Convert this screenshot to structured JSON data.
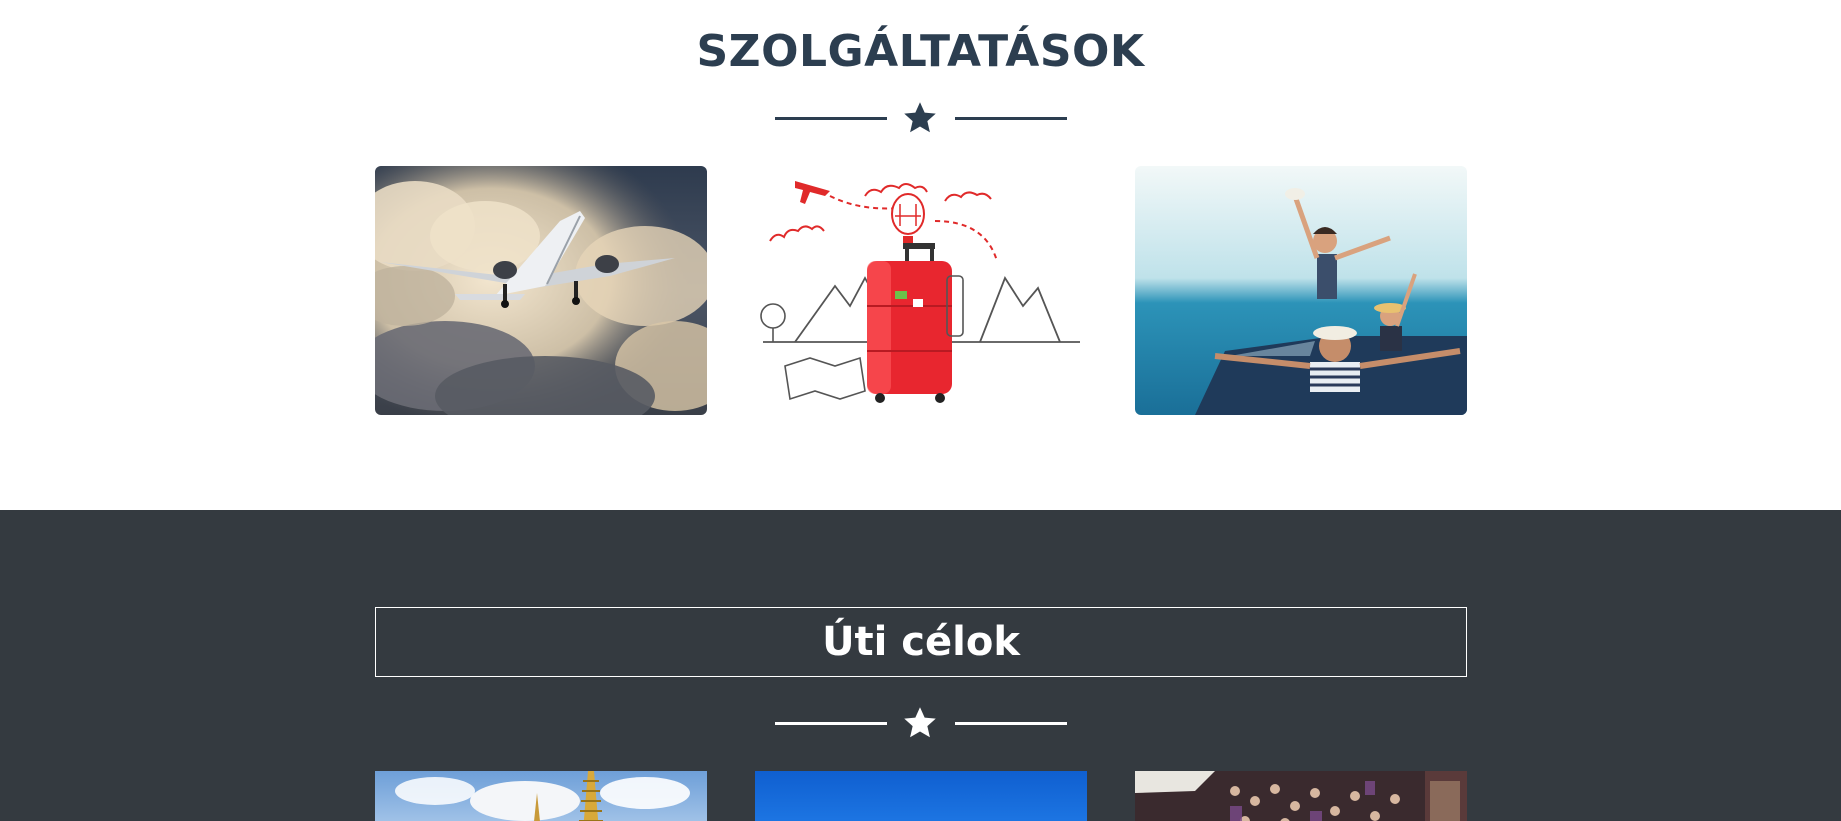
{
  "services": {
    "title": "SZOLGÁLTATÁSOK",
    "divider_icon": "star-icon",
    "accent_color": "#2c3e50",
    "cards": [
      {
        "image": "airplane-photo"
      },
      {
        "image": "travel-suitcase-illustration"
      },
      {
        "image": "family-convertible-photo"
      }
    ]
  },
  "destinations": {
    "title": "Úti célok",
    "divider_icon": "star-icon",
    "background_color": "#343a40",
    "cards": [
      {
        "image": "temple-photo"
      },
      {
        "image": "blue-sky-photo"
      },
      {
        "image": "market-crowd-photo"
      }
    ]
  }
}
